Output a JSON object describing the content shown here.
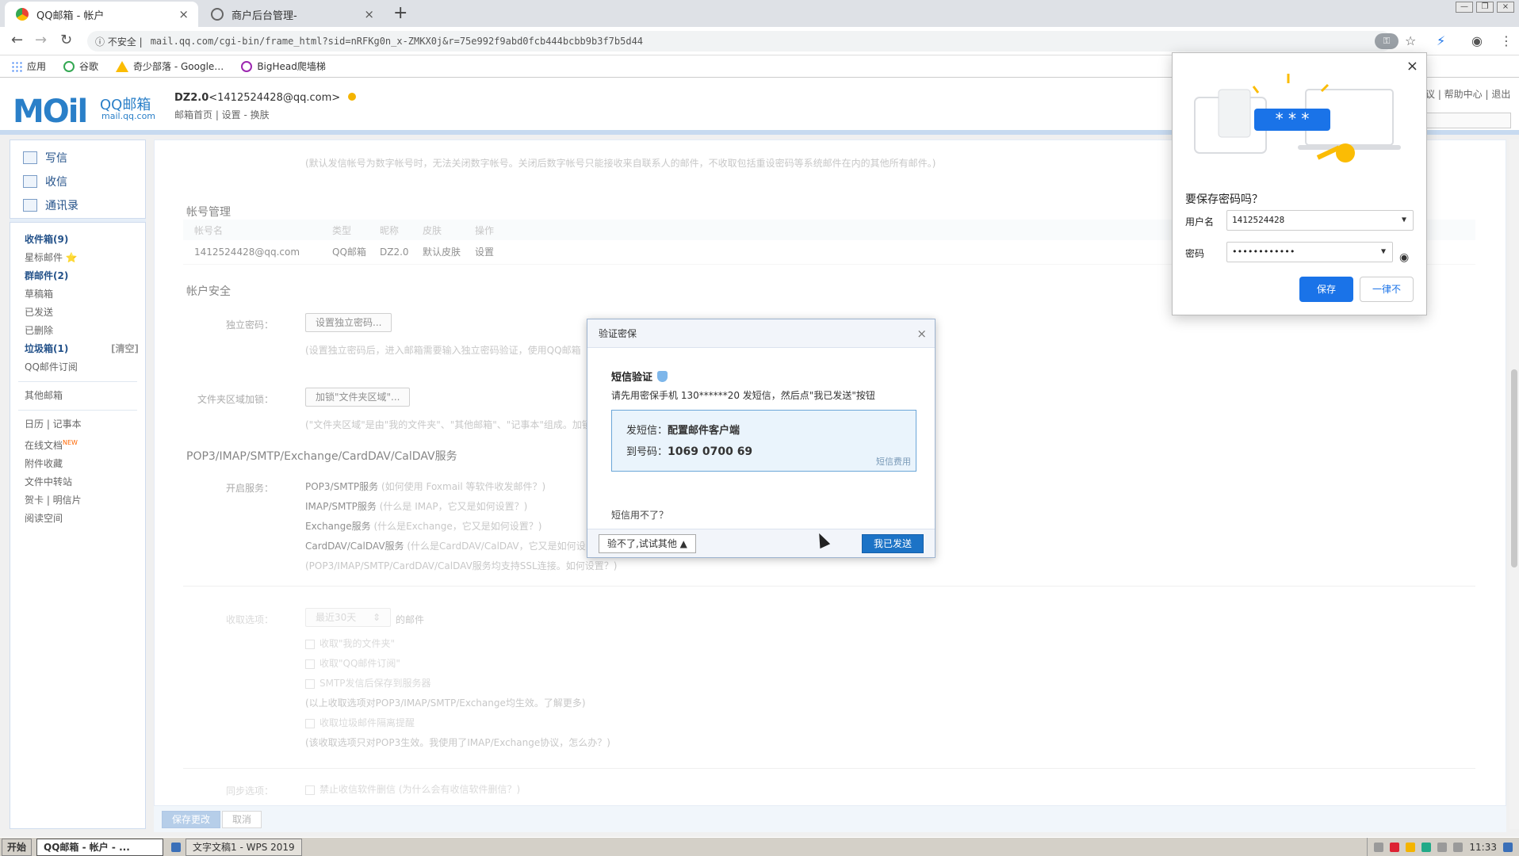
{
  "browser": {
    "tabs": [
      {
        "title": "QQ邮箱 - 帐户",
        "close": "×"
      },
      {
        "title": "商户后台管理-",
        "close": "×"
      }
    ],
    "new_tab": "+",
    "win_controls": [
      "—",
      "❐",
      "×"
    ],
    "insecure_label": "不安全",
    "url": "mail.qq.com/cgi-bin/frame_html?sid=nRFKg0n_x-ZMKX0j&r=75e992f9abd0fcb444bcbb9b3f7b5d44",
    "bookmarks": [
      {
        "label": "应用",
        "icon": "apps-grid-icon",
        "color": "#4285f4"
      },
      {
        "label": "谷歌",
        "icon": "google-icon",
        "color": "#34a853"
      },
      {
        "label": "奇少部落 - Google…",
        "icon": "drive-icon",
        "color": "#fbbc04"
      },
      {
        "label": "BigHead爬墙梯",
        "icon": "bighead-icon",
        "color": "#9c27b0"
      }
    ]
  },
  "header": {
    "logo": "MOil",
    "logo_text": "QQ邮箱",
    "logo_domain": "mail.qq.com",
    "account_name": "DZ2.0",
    "account_email": "<1412524428@qq.com>",
    "links": "邮箱首页 | 设置 - 换肤",
    "top_links": "议 | 帮助中心 | 退出"
  },
  "sidebar": {
    "actions": [
      {
        "label": "写信",
        "icon": "compose-icon"
      },
      {
        "label": "收信",
        "icon": "inbox-icon"
      },
      {
        "label": "通讯录",
        "icon": "contacts-icon"
      }
    ],
    "folders": [
      {
        "label": "收件箱(9)",
        "bold": true
      },
      {
        "label": "星标邮件 ⭐",
        "bold": false
      },
      {
        "label": "群邮件(2)",
        "bold": true
      },
      {
        "label": "草稿箱",
        "bold": false
      },
      {
        "label": "已发送",
        "bold": false
      },
      {
        "label": "已删除",
        "bold": false
      },
      {
        "label": "垃圾箱(1)",
        "bold": true,
        "extra": "[清空]"
      },
      {
        "label": "QQ邮件订阅",
        "bold": false
      }
    ],
    "other": "其他邮箱",
    "tools": [
      "日历 | 记事本",
      "在线文档",
      "附件收藏",
      "文件中转站",
      "贺卡 | 明信片",
      "阅读空间"
    ],
    "new_tag": "NEW"
  },
  "main": {
    "digital_note": "(默认发信帐号为数字帐号时，无法关闭数字帐号。关闭后数字帐号只能接收来自联系人的邮件，不收取包括重设密码等系统邮件在内的其他所有邮件。)",
    "account_mgmt_title": "帐号管理",
    "account_table": {
      "headers": [
        "帐号名",
        "类型",
        "昵称",
        "皮肤",
        "操作"
      ],
      "row": [
        "1412524428@qq.com",
        "QQ邮箱",
        "DZ2.0",
        "默认皮肤",
        "设置"
      ]
    },
    "security_title": "帐户安全",
    "independent_pwd_label": "独立密码：",
    "independent_pwd_button": "设置独立密码...",
    "independent_pwd_note": "(设置独立密码后，进入邮箱需要输入独立密码验证，使用QQ邮箱",
    "folder_lock_label": "文件夹区域加锁：",
    "folder_lock_button": "加锁\"文件夹区域\"...",
    "folder_lock_note": "(\"文件夹区域\"是由\"我的文件夹\"、\"其他邮箱\"、\"记事本\"组成。加锁",
    "pop_title": "POP3/IMAP/SMTP/Exchange/CardDAV/CalDAV服务",
    "open_service_label": "开启服务：",
    "services": [
      {
        "name": "POP3/SMTP服务",
        "hint": "(如何使用 Foxmail 等软件收发邮件？)"
      },
      {
        "name": "IMAP/SMTP服务",
        "hint": "(什么是 IMAP，它又是如何设置？)"
      },
      {
        "name": "Exchange服务",
        "hint": "(什么是Exchange，它又是如何设置？)"
      },
      {
        "name": "CardDAV/CalDAV服务",
        "hint": "(什么是CardDAV/CalDAV，它又是如何设"
      }
    ],
    "ssl_note": "(POP3/IMAP/SMTP/CardDAV/CalDAV服务均支持SSL连接。如何设置？)",
    "receive_label": "收取选项：",
    "receive_select": "最近30天",
    "receive_suffix": "的邮件",
    "receive_checks": [
      "收取\"我的文件夹\"",
      "收取\"QQ邮件订阅\"",
      "SMTP发信后保存到服务器"
    ],
    "receive_note1": "(以上收取选项对POP3/IMAP/SMTP/Exchange均生效。了解更多)",
    "receive_check_spam": "收取垃圾邮件隔离提醒",
    "receive_note2": "(该收取选项只对POP3生效。我使用了IMAP/Exchange协议，怎么办？)",
    "sync_label": "同步选项：",
    "sync_check": "禁止收信软件删信 (为什么会有收信软件删信？)",
    "save_button": "保存更改",
    "cancel_button": "取消"
  },
  "modal": {
    "title": "验证密保",
    "close": "×",
    "heading": "短信验证",
    "instruction": "请先用密保手机 130******20 发短信，然后点\"我已发送\"按钮",
    "sms_label": "发短信：",
    "sms_content": "配置邮件客户端",
    "to_label": "到号码：",
    "to_number": "1069 0700 69",
    "fee": "短信费用",
    "question": "短信用不了？",
    "alt_button": "验不了,试试其他 ▲",
    "send_button": "我已发送"
  },
  "password_popup": {
    "title": "要保存密码吗？",
    "username_label": "用户名",
    "username_value": "1412524428",
    "password_label": "密码",
    "password_value": "••••••••••••",
    "save_button": "保存",
    "never_button": "一律不",
    "close": "×",
    "illustration_text": "* * *"
  },
  "taskbar": {
    "start": "开始",
    "windows": [
      "QQ邮箱 - 帐户 - ...",
      "文字文稿1 - WPS 2019"
    ],
    "clock": "11:33"
  }
}
